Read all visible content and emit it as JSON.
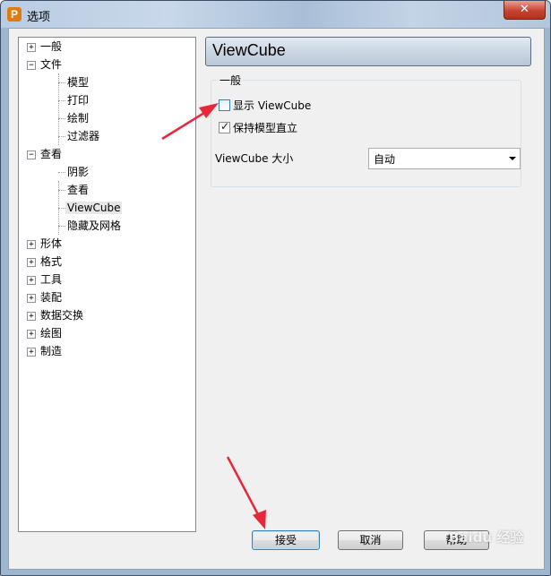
{
  "window": {
    "title": "选项",
    "app_icon_letter": "P",
    "close_glyph": "✕"
  },
  "tree": {
    "items": [
      {
        "label": "一般",
        "expander": "+"
      },
      {
        "label": "文件",
        "expander": "−"
      },
      {
        "label": "模型"
      },
      {
        "label": "打印"
      },
      {
        "label": "绘制"
      },
      {
        "label": "过滤器"
      },
      {
        "label": "查看",
        "expander": "−"
      },
      {
        "label": "阴影"
      },
      {
        "label": "查看"
      },
      {
        "label": "ViewCube",
        "selected": true
      },
      {
        "label": "隐藏及网格"
      },
      {
        "label": "形体",
        "expander": "+"
      },
      {
        "label": "格式",
        "expander": "+"
      },
      {
        "label": "工具",
        "expander": "+"
      },
      {
        "label": "装配",
        "expander": "+"
      },
      {
        "label": "数据交换",
        "expander": "+"
      },
      {
        "label": "绘图",
        "expander": "+"
      },
      {
        "label": "制造",
        "expander": "+"
      }
    ]
  },
  "panel": {
    "title": "ViewCube",
    "group_label": "一般",
    "show_viewcube": {
      "label": "显示 ViewCube",
      "checked": false
    },
    "keep_upright": {
      "label": "保持模型直立",
      "checked": true,
      "check_glyph": "✓"
    },
    "size_label": "ViewCube 大小",
    "size_value": "自动"
  },
  "buttons": {
    "accept": "接受",
    "cancel": "取消",
    "help": "帮助"
  },
  "watermark": "Baidu 经验",
  "colors": {
    "annotation_arrow": "#e8283a",
    "title_bar": "#b9cce2",
    "close_button": "#c7432f"
  }
}
